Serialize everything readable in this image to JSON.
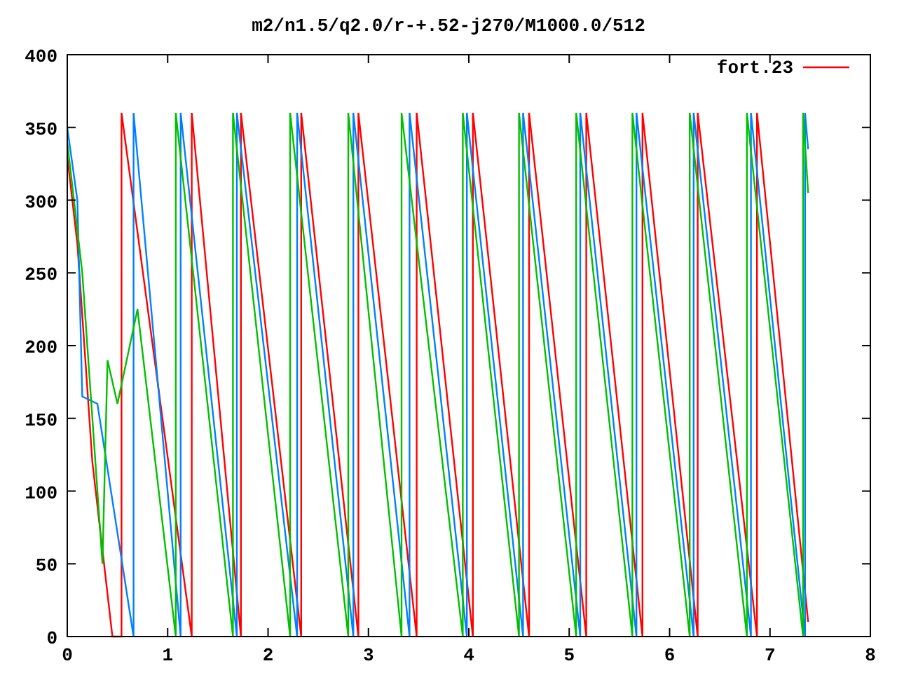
{
  "chart_data": {
    "type": "line",
    "title": "m2/n1.5/q2.0/r-+.52-j270/M1000.0/512",
    "xlim": [
      0,
      8
    ],
    "ylim": [
      0,
      400
    ],
    "xticks": [
      0,
      1,
      2,
      3,
      4,
      5,
      6,
      7,
      8
    ],
    "yticks": [
      0,
      50,
      100,
      150,
      200,
      250,
      300,
      350,
      400
    ],
    "series": [
      {
        "name": "fort.23",
        "color": "#ff0000",
        "x": [
          0,
          0.1,
          0.25,
          0.45,
          0.54,
          0.54,
          1.24,
          1.24,
          1.73,
          1.73,
          2.33,
          2.33,
          2.9,
          2.9,
          3.48,
          3.48,
          4.04,
          4.04,
          4.6,
          4.6,
          5.17,
          5.17,
          5.73,
          5.73,
          6.28,
          6.28,
          6.87,
          6.87,
          7.38
        ],
        "values": [
          330,
          270,
          120,
          0,
          0,
          360,
          0,
          360,
          0,
          360,
          0,
          360,
          0,
          360,
          0,
          360,
          0,
          360,
          0,
          360,
          0,
          360,
          0,
          360,
          0,
          360,
          0,
          360,
          10
        ]
      },
      {
        "color": "#0080ff",
        "x": [
          0,
          0.1,
          0.15,
          0.3,
          0.66,
          0.66,
          1.13,
          1.13,
          1.69,
          1.69,
          2.29,
          2.29,
          2.85,
          2.85,
          3.41,
          3.41,
          3.98,
          3.98,
          4.54,
          4.54,
          5.11,
          5.11,
          5.67,
          5.67,
          6.24,
          6.24,
          6.81,
          6.81,
          7.35,
          7.35,
          7.38
        ],
        "values": [
          350,
          300,
          165,
          160,
          0,
          360,
          0,
          360,
          0,
          360,
          0,
          360,
          0,
          360,
          0,
          360,
          0,
          360,
          0,
          360,
          0,
          360,
          0,
          360,
          0,
          360,
          0,
          360,
          0,
          360,
          335
        ]
      },
      {
        "color": "#00c000",
        "x": [
          0,
          0.15,
          0.35,
          0.4,
          0.5,
          0.7,
          1.08,
          1.08,
          1.65,
          1.65,
          2.22,
          2.22,
          2.8,
          2.8,
          3.33,
          3.33,
          3.94,
          3.94,
          4.5,
          4.5,
          5.07,
          5.07,
          5.63,
          5.63,
          6.2,
          6.2,
          6.77,
          6.77,
          7.33,
          7.33,
          7.38
        ],
        "values": [
          340,
          250,
          50,
          190,
          160,
          225,
          0,
          360,
          0,
          360,
          0,
          360,
          0,
          360,
          0,
          360,
          0,
          360,
          0,
          360,
          0,
          360,
          0,
          360,
          0,
          360,
          0,
          360,
          0,
          360,
          305
        ]
      }
    ]
  }
}
